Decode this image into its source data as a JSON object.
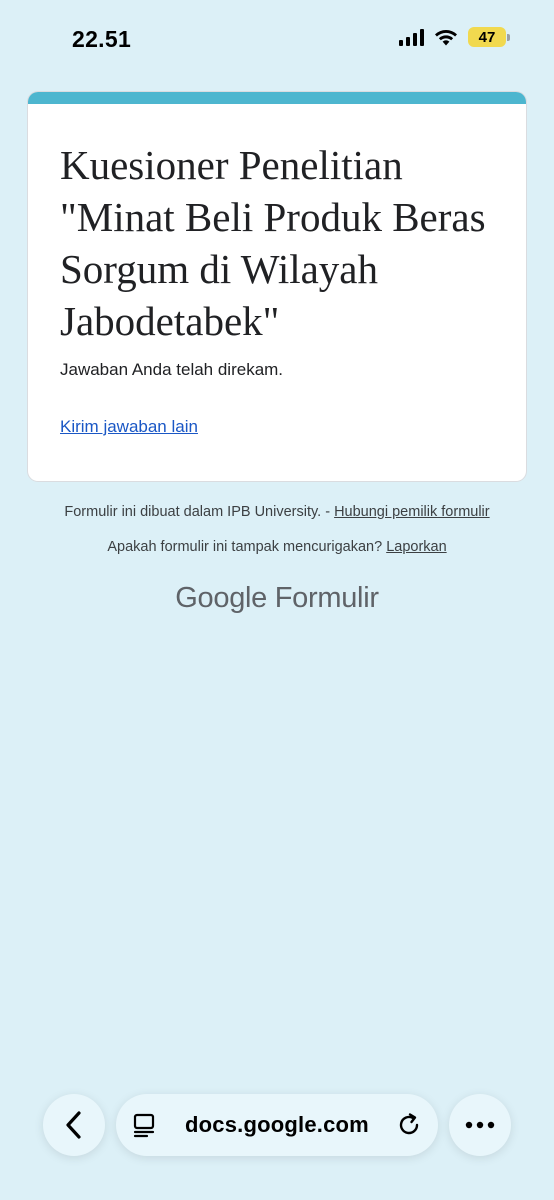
{
  "status_bar": {
    "time": "22.51",
    "battery": "47"
  },
  "form": {
    "title": "Kuesioner Penelitian \"Minat Beli Produk Beras Sorgum di Wilayah Jabodetabek\"",
    "confirmation": "Jawaban Anda telah direkam.",
    "submit_another_link": "Kirim jawaban lain",
    "accent_color": "#4db6cf"
  },
  "footer": {
    "created_in": "Formulir ini dibuat dalam IPB University. -",
    "contact_owner_link": "Hubungi pemilik formulir",
    "suspicious_question": "Apakah formulir ini tampak mencurigakan?",
    "report_link": "Laporkan",
    "brand_google": "Google",
    "brand_product": "Formulir"
  },
  "browser": {
    "url": "docs.google.com",
    "icons": [
      "back-icon",
      "page-menu-icon",
      "reload-icon",
      "more-icon"
    ]
  }
}
